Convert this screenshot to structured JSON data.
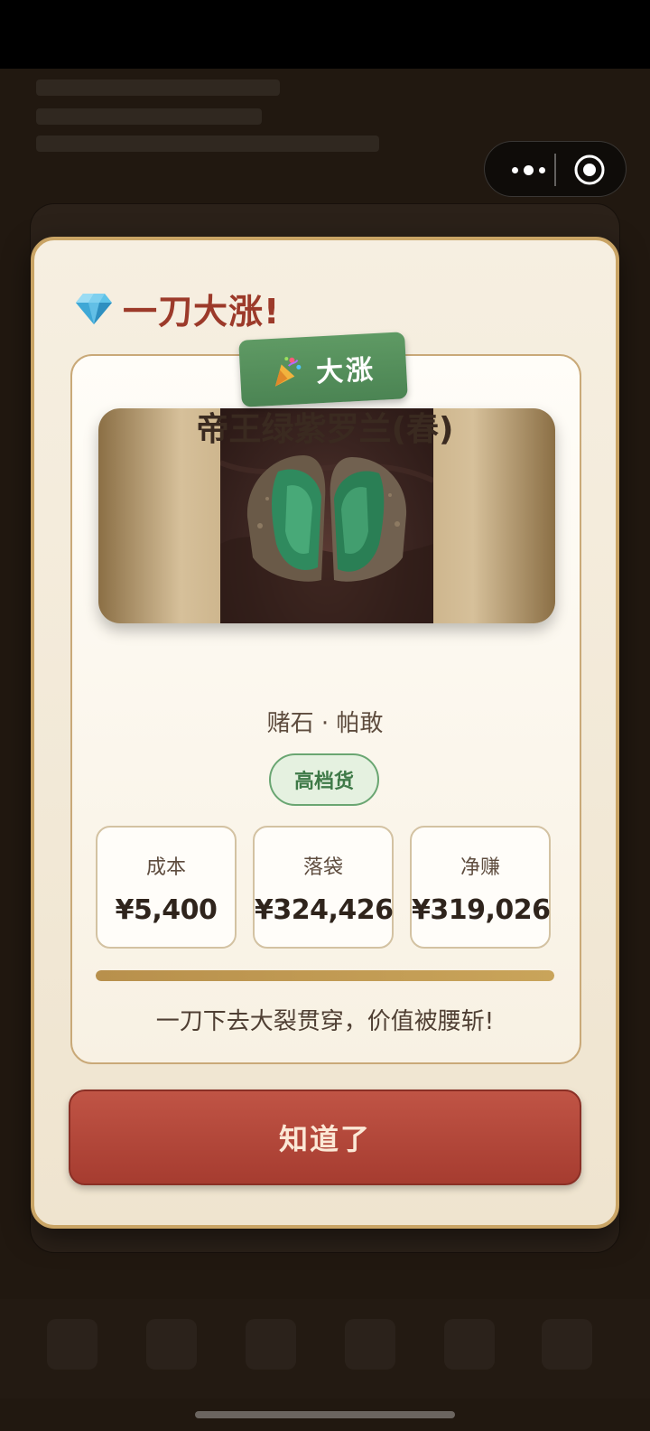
{
  "modal": {
    "title": "一刀大涨!",
    "badge_label": "大涨",
    "stone_name": "帝王绿紫罗兰(春)",
    "stone_type": "赌石 · 帕敢",
    "grade": "高档货",
    "stats": [
      {
        "label": "成本",
        "value": "¥5,400"
      },
      {
        "label": "落袋",
        "value": "¥324,426"
      },
      {
        "label": "净赚",
        "value": "¥319,026"
      }
    ],
    "progress_fraction": 1.0,
    "result_message": "一刀下去大裂贯穿，价值被腰斩!",
    "ok_button_label": "知道了"
  },
  "colors": {
    "accent_red": "#a63c30",
    "accent_green": "#4b8453",
    "gold": "#c9a465"
  },
  "icons": {
    "title_icon": "gem-icon",
    "badge_icon": "party-popper-icon",
    "capsule_more": "more-dots-icon",
    "capsule_close": "target-close-icon"
  }
}
